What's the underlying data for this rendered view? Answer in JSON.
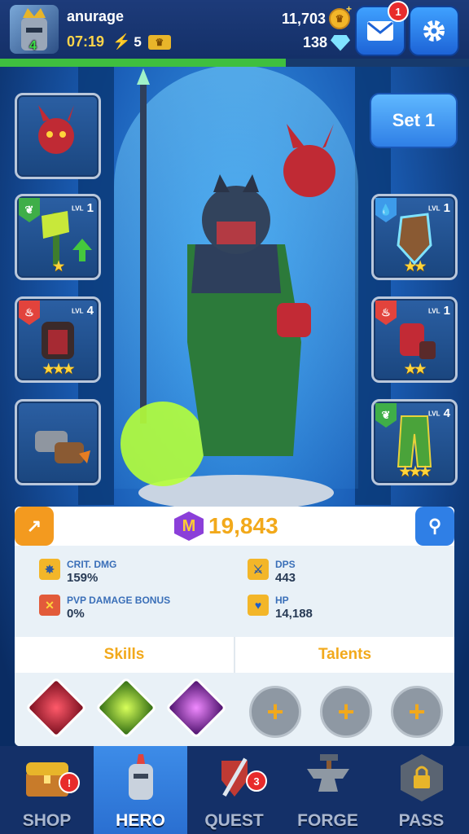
{
  "player": {
    "name": "anurage",
    "level": "4",
    "timer": "07:19",
    "energy": "5",
    "coins": "11,703",
    "gems": "138",
    "mail_badge": "1"
  },
  "equipment": {
    "set_label": "Set 1",
    "left": [
      {
        "name": "pet",
        "level": "",
        "stars": "",
        "element": ""
      },
      {
        "name": "axe",
        "level": "1",
        "stars": "★",
        "element": "nature"
      },
      {
        "name": "armor",
        "level": "4",
        "stars": "★★★",
        "element": "fire"
      },
      {
        "name": "boots",
        "level": "",
        "stars": "",
        "element": ""
      }
    ],
    "right": [
      {
        "name": "shield",
        "level": "1",
        "stars": "★★",
        "element": "water"
      },
      {
        "name": "gauntlet",
        "level": "1",
        "stars": "★★",
        "element": "fire"
      },
      {
        "name": "leggings",
        "level": "4",
        "stars": "★★★",
        "element": "nature"
      }
    ],
    "lvl_text": "LVL"
  },
  "power": "19,843",
  "stats": {
    "crit_label": "CRIT. DMG",
    "crit_value": "159%",
    "dps_label": "DPS",
    "dps_value": "443",
    "pvp_label": "PVP DAMAGE BONUS",
    "pvp_value": "0%",
    "hp_label": "HP",
    "hp_value": "14,188"
  },
  "tabs": {
    "skills": "Skills",
    "talents": "Talents"
  },
  "talent_plus": "+",
  "nav": {
    "shop": "SHOP",
    "hero": "HERO",
    "quest": "QUEST",
    "forge": "FORGE",
    "pass": "PASS",
    "quest_badge": "3",
    "shop_badge": "!"
  },
  "colors": {
    "accent_gold": "#f2a91b",
    "primary_blue": "#2f7fe6",
    "badge_red": "#e82b2b"
  }
}
